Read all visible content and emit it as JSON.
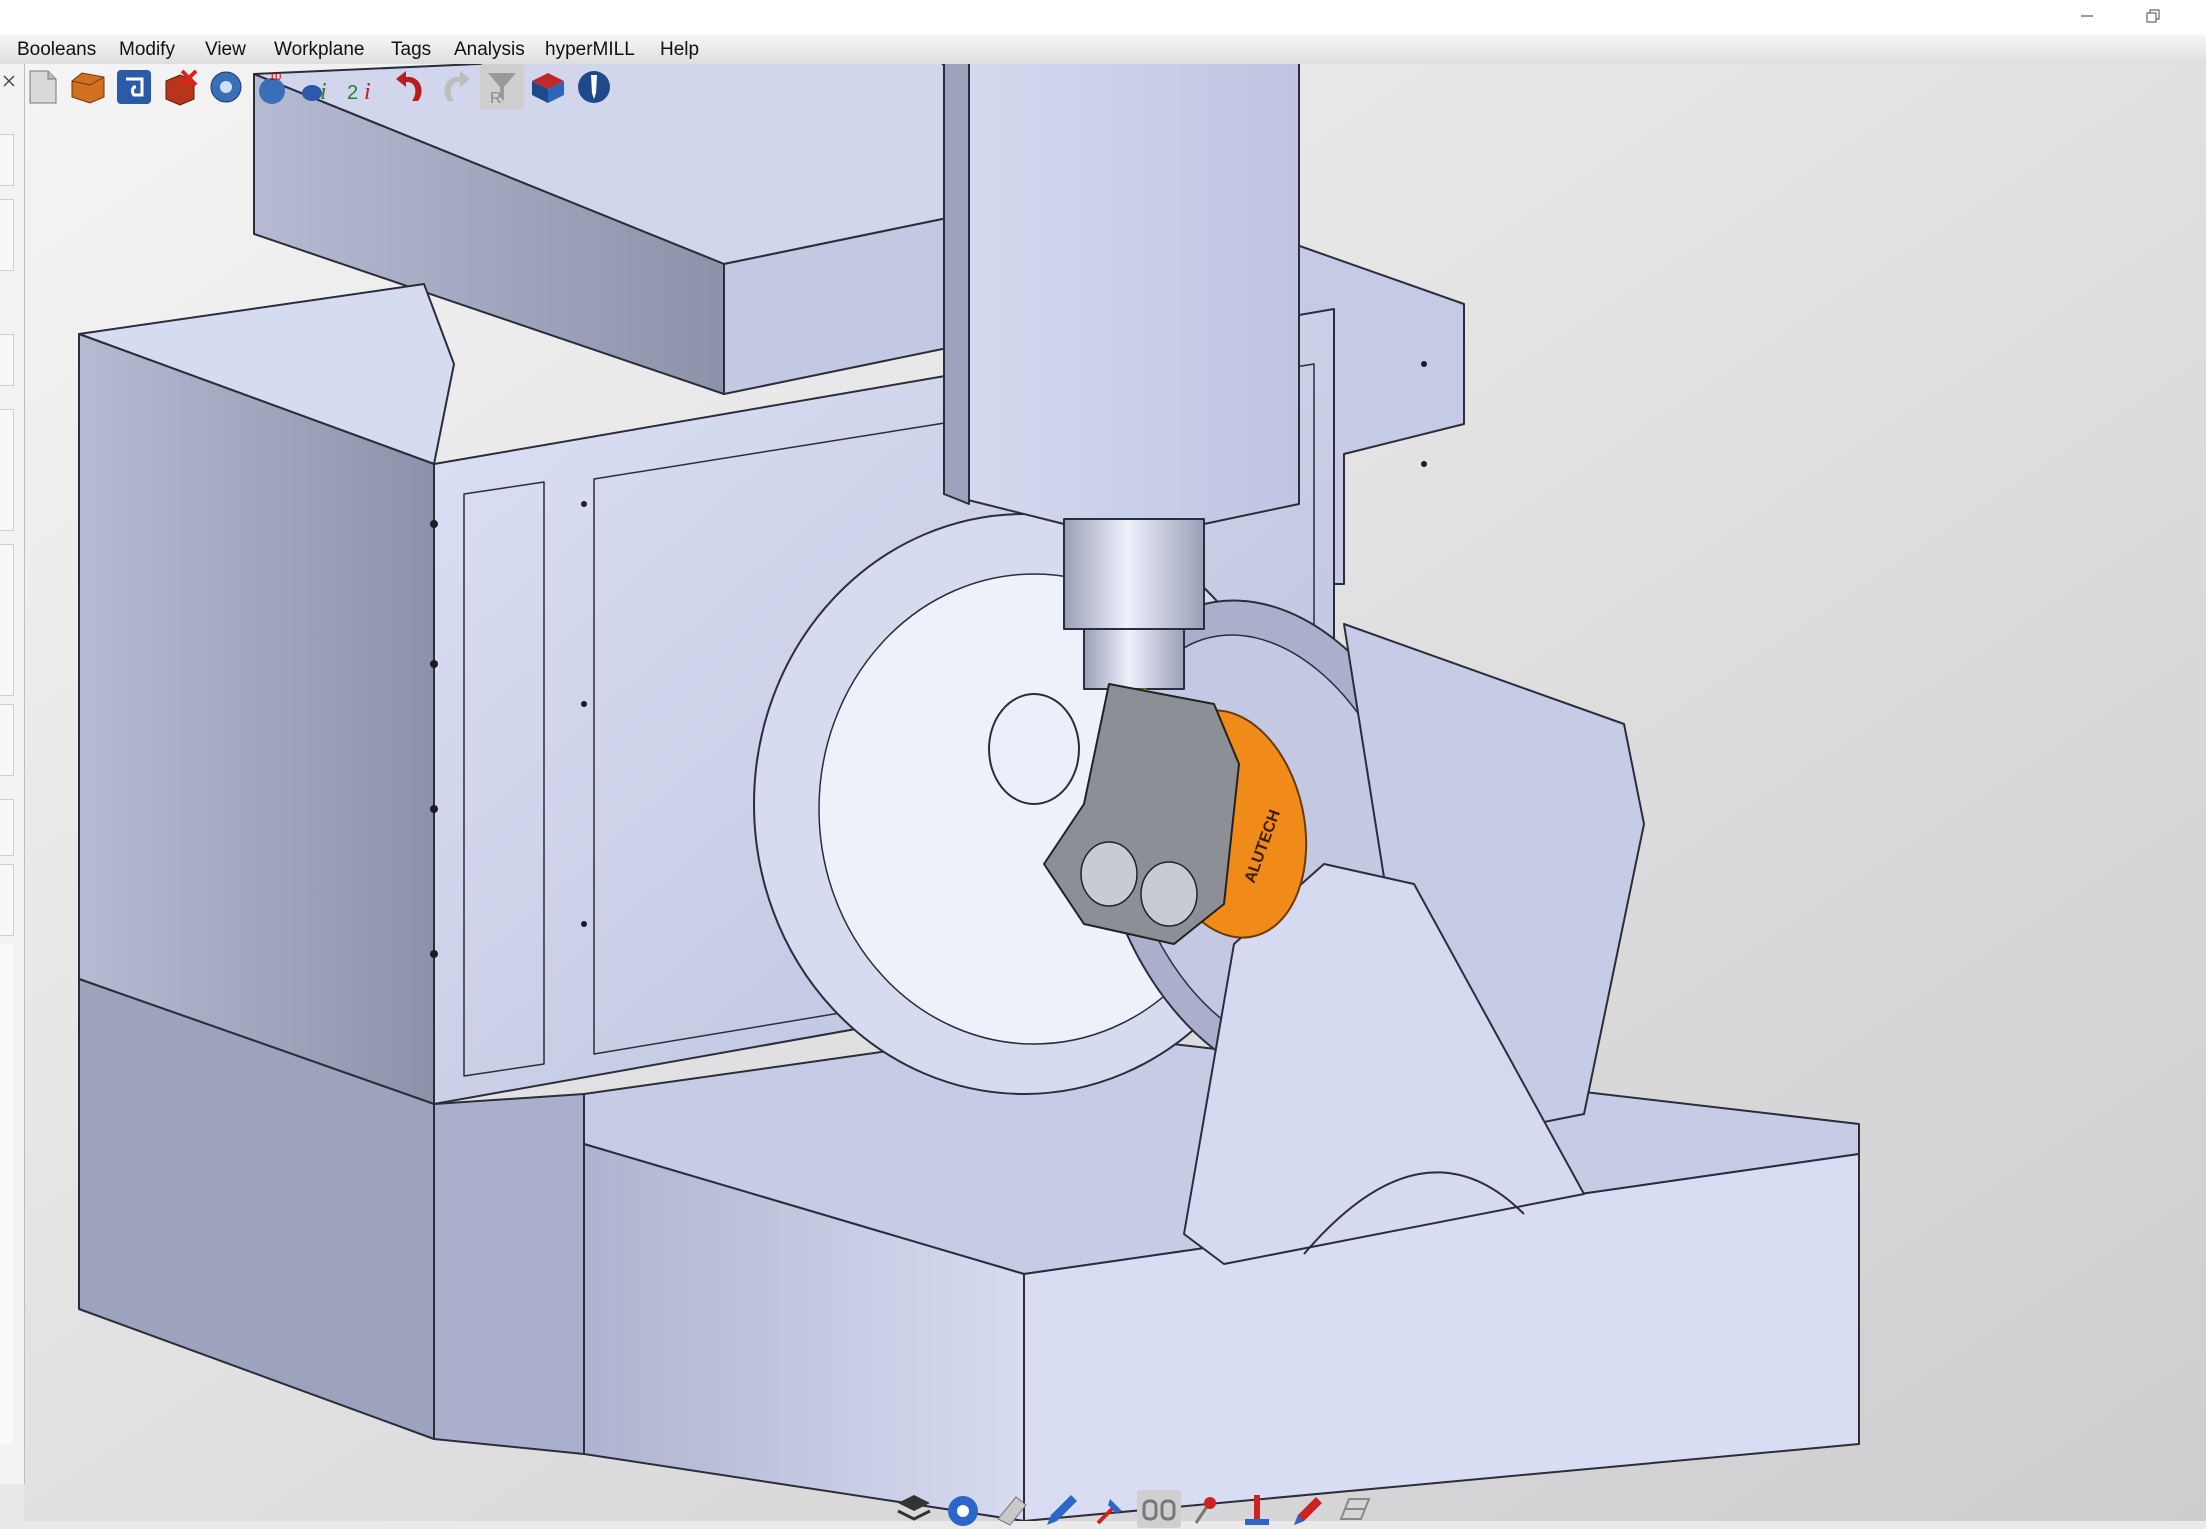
{
  "menu": {
    "items": [
      "Booleans",
      "Modify",
      "View",
      "Workplane",
      "Tags",
      "Analysis",
      "hyperMILL",
      "Help"
    ]
  },
  "window_controls": {
    "minimize": "minimize-icon",
    "restore": "restore-icon"
  },
  "toolbar": {
    "icons": [
      "new-file-icon",
      "open-part-icon",
      "magnet-icon",
      "delete-icon",
      "settings-gear-icon",
      "calculate-10-icon",
      "info-i-icon",
      "info-2i-icon",
      "undo-icon",
      "redo-icon",
      "filter-r-icon",
      "part-box-icon",
      "probe-icon"
    ]
  },
  "bottom_toolbar": {
    "icons": [
      "layer-stack-icon",
      "globe-icon",
      "eraser-icon",
      "pencil-icon",
      "pin-icon",
      "glasses-icon",
      "node-icon",
      "measure-icon",
      "pen-icon",
      "wireframe-icon"
    ]
  },
  "viewport": {
    "part_label": "ALUTECH",
    "colors": {
      "machine": "#c9cfec",
      "machine_dark": "#8f94ad",
      "edge": "#2a2d3a",
      "fixture": "#f08a18",
      "tool": "#f1f200"
    }
  }
}
